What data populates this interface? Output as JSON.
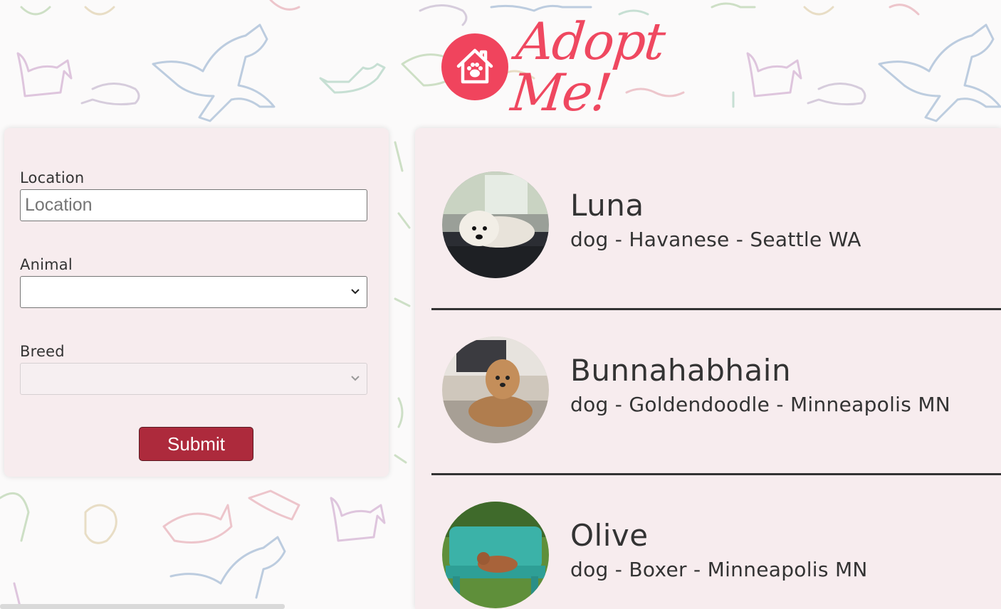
{
  "header": {
    "title": "Adopt Me!",
    "logo_icon": "house-paw-icon"
  },
  "search": {
    "location_label": "Location",
    "location_value": "",
    "location_placeholder": "Location",
    "animal_label": "Animal",
    "animal_value": "",
    "breed_label": "Breed",
    "breed_value": "",
    "submit_label": "Submit"
  },
  "pets": [
    {
      "name": "Luna",
      "info": "dog - Havanese - Seattle WA"
    },
    {
      "name": "Bunnahabhain",
      "info": "dog - Goldendoodle - Minneapolis MN"
    },
    {
      "name": "Olive",
      "info": "dog - Boxer - Minneapolis MN"
    }
  ],
  "colors": {
    "brand": "#ef4860",
    "panel": "#f7ecee",
    "button": "#ad2a3c"
  }
}
